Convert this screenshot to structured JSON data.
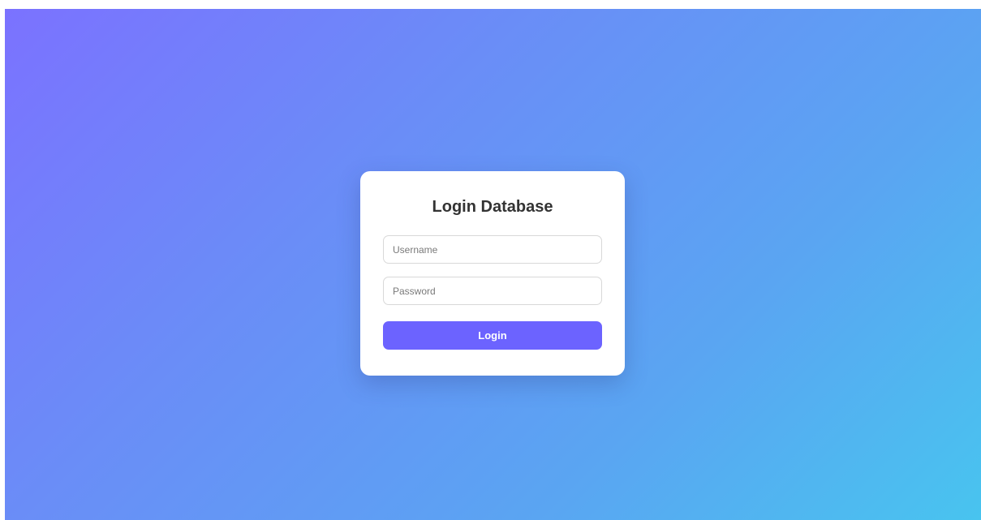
{
  "login": {
    "title": "Login Database",
    "username_placeholder": "Username",
    "password_placeholder": "Password",
    "submit_label": "Login"
  },
  "colors": {
    "gradient_start": "#7b72ff",
    "gradient_end": "#48c4ef",
    "button": "#6c63ff",
    "card": "#ffffff",
    "title_text": "#333333"
  }
}
